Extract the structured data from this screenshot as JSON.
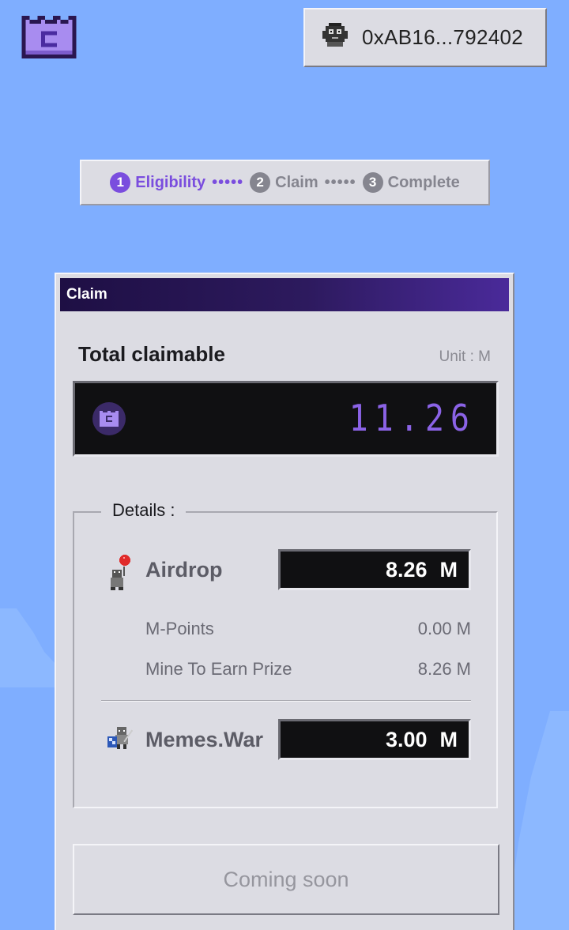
{
  "header": {
    "wallet_address": "0xAB16...792402"
  },
  "stepper": {
    "steps": [
      {
        "num": "1",
        "label": "Eligibility"
      },
      {
        "num": "2",
        "label": "Claim"
      },
      {
        "num": "3",
        "label": "Complete"
      }
    ],
    "connector": "•••••"
  },
  "claim_window": {
    "title": "Claim",
    "total_label": "Total claimable",
    "unit_label": "Unit : M",
    "total_value": "11.26",
    "details_label": "Details :",
    "airdrop": {
      "label": "Airdrop",
      "value": "8.26",
      "unit": "M",
      "breakdown": [
        {
          "label": "M-Points",
          "value": "0.00 M"
        },
        {
          "label": "Mine To Earn Prize",
          "value": "8.26 M"
        }
      ]
    },
    "memes_war": {
      "label": "Memes.War",
      "value": "3.00",
      "unit": "M"
    },
    "action_button": "Coming soon"
  },
  "colors": {
    "background": "#7faeff",
    "accent": "#7a4dde",
    "panel": "#dcdce3",
    "display_bg": "#101012"
  }
}
